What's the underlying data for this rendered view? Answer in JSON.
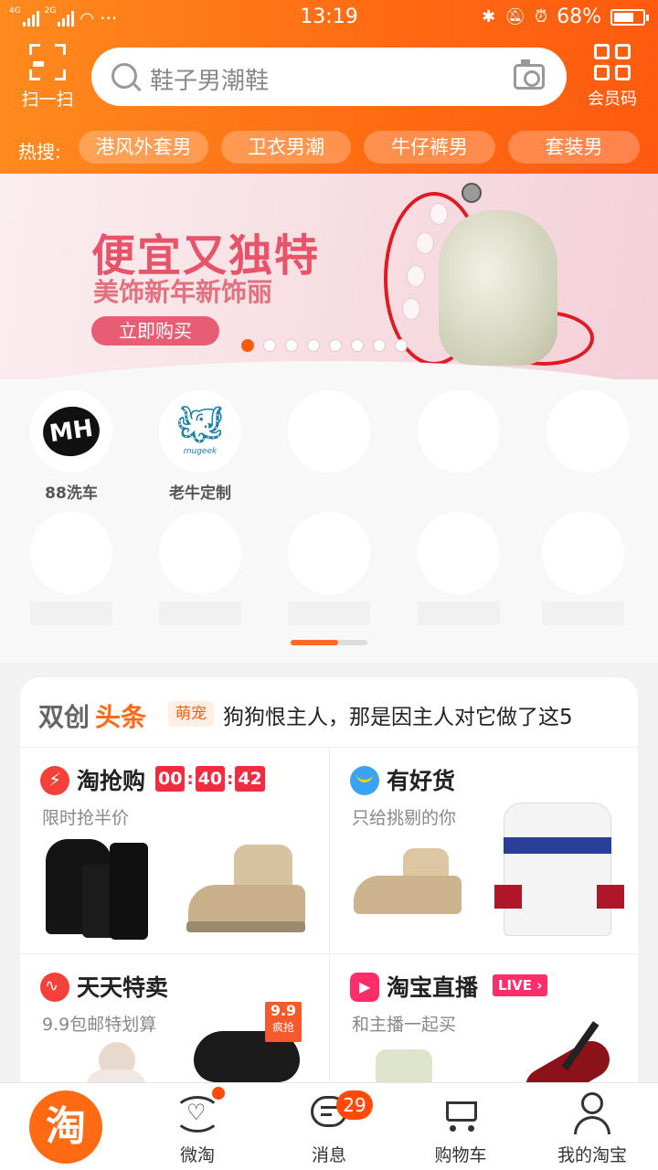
{
  "status": {
    "net1": "4G",
    "net2": "2G",
    "more": "···",
    "time": "13:19",
    "battery": "68%"
  },
  "header": {
    "scan_label": "扫一扫",
    "search_placeholder": "鞋子男潮鞋",
    "member_label": "会员码"
  },
  "hot": {
    "title": "热搜:",
    "chips": [
      "港风外套男",
      "卫衣男潮",
      "牛仔裤男",
      "套装男"
    ]
  },
  "banner": {
    "headline": "便宜又独特",
    "subline": "美饰新年新饰丽",
    "button": "立即购买",
    "dots": 8,
    "active_dot": 0
  },
  "channels": [
    {
      "label": "88洗车",
      "logo": "MH"
    },
    {
      "label": "老牛定制",
      "logo": "mugeek"
    }
  ],
  "card": {
    "news": {
      "logo_a": "双创",
      "logo_b": "头条",
      "tag": "萌宠",
      "text": "狗狗恨主人，那是因主人对它做了这5"
    },
    "sections": [
      {
        "title": "淘抢购",
        "subtitle": "限时抢半价",
        "timer": [
          "00",
          "40",
          "42"
        ],
        "icon_color": "#f5413a"
      },
      {
        "title": "有好货",
        "subtitle": "只给挑剔的你",
        "icon_color": "#3aa3f2"
      },
      {
        "title": "天天特卖",
        "subtitle": "9.9包邮特划算",
        "badge": [
          "9.9",
          "疯抢"
        ],
        "icon_color": "#f5413a"
      },
      {
        "title": "淘宝直播",
        "subtitle": "和主播一起买",
        "live": "LIVE",
        "icon_color": "#ff2e6b"
      }
    ]
  },
  "tabs": [
    {
      "label": "淘",
      "icon": "taobao-home-icon"
    },
    {
      "label": "微淘",
      "icon": "weitao-icon"
    },
    {
      "label": "消息",
      "icon": "message-icon",
      "count": "29"
    },
    {
      "label": "购物车",
      "icon": "cart-icon"
    },
    {
      "label": "我的淘宝",
      "icon": "profile-icon"
    }
  ],
  "colors": {
    "brand": "#ff6a12",
    "accent_red": "#f32b3f",
    "live_pink": "#ff2e6b"
  }
}
